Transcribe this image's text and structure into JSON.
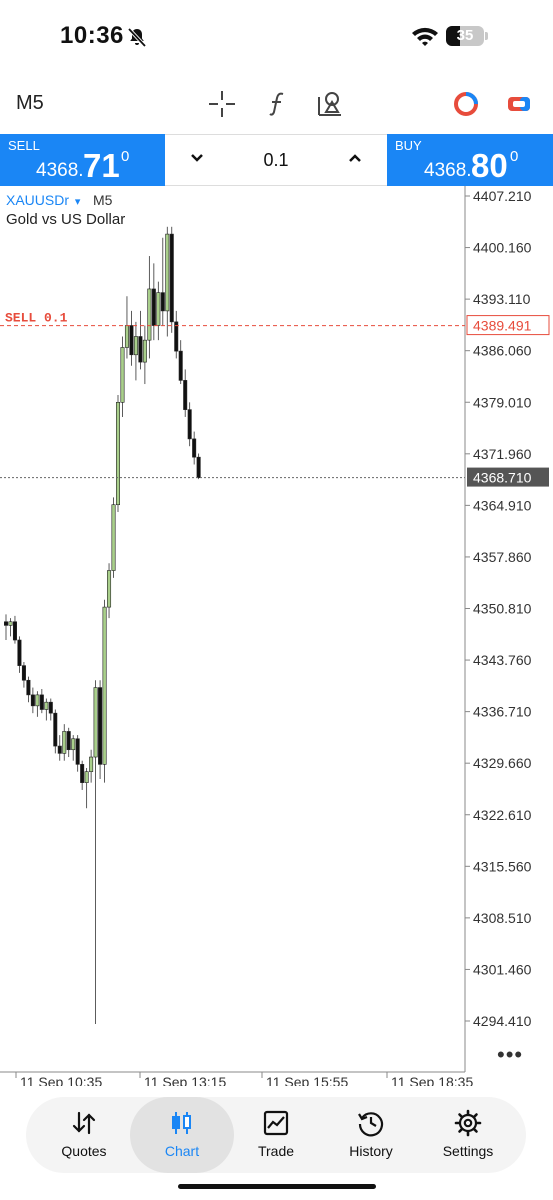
{
  "status_bar": {
    "time": "10:36",
    "battery": "35"
  },
  "toolbar": {
    "timeframe": "M5",
    "tool_icons": [
      "crosshair-icon",
      "function-icon",
      "objects-icon",
      "indicator-ring-icon",
      "trade-toggle-icon"
    ]
  },
  "trade_panel": {
    "sell": {
      "label": "SELL",
      "price_prefix": "4368.",
      "price_big": "71",
      "price_sup": "0"
    },
    "buy": {
      "label": "BUY",
      "price_prefix": "4368.",
      "price_big": "80",
      "price_sup": "0"
    },
    "volume": "0.1"
  },
  "chart": {
    "symbol": "XAUUSDr",
    "symbol_arrow": "▾",
    "timeframe": "M5",
    "description": "Gold vs US Dollar",
    "order_line_label": "SELL 0.1",
    "order_price": "4389.491",
    "current_price": "4368.710",
    "price_axis": [
      "4407.210",
      "4400.160",
      "4393.110",
      "4386.060",
      "4379.010",
      "4371.960",
      "4364.910",
      "4357.860",
      "4350.810",
      "4343.760",
      "4336.710",
      "4329.660",
      "4322.610",
      "4315.560",
      "4308.510",
      "4301.460",
      "4294.410"
    ],
    "time_axis": [
      "11 Sep 10:35",
      "11 Sep 13:15",
      "11 Sep 15:55",
      "11 Sep 18:35"
    ],
    "more": "•••",
    "colors": {
      "up": "#a9cf8b",
      "down": "#111111",
      "sell_line": "#e74c3c",
      "accent": "#1a86f5"
    }
  },
  "chart_data": {
    "type": "candlestick",
    "symbol": "XAUUSDr",
    "ylim": [
      4290.0,
      4409.0
    ],
    "candles": [
      {
        "o": 4349.0,
        "h": 4350.0,
        "l": 4346.5,
        "c": 4348.5
      },
      {
        "o": 4348.5,
        "h": 4349.5,
        "l": 4347.0,
        "c": 4349.0
      },
      {
        "o": 4349.0,
        "h": 4349.8,
        "l": 4346.0,
        "c": 4346.5
      },
      {
        "o": 4346.5,
        "h": 4347.0,
        "l": 4342.0,
        "c": 4343.0
      },
      {
        "o": 4343.0,
        "h": 4343.5,
        "l": 4340.0,
        "c": 4341.0
      },
      {
        "o": 4341.0,
        "h": 4341.5,
        "l": 4338.0,
        "c": 4339.0
      },
      {
        "o": 4339.0,
        "h": 4340.0,
        "l": 4336.5,
        "c": 4337.5
      },
      {
        "o": 4337.5,
        "h": 4339.5,
        "l": 4336.0,
        "c": 4339.0
      },
      {
        "o": 4339.0,
        "h": 4339.8,
        "l": 4336.5,
        "c": 4337.0
      },
      {
        "o": 4337.0,
        "h": 4338.5,
        "l": 4335.5,
        "c": 4338.0
      },
      {
        "o": 4338.0,
        "h": 4338.5,
        "l": 4335.5,
        "c": 4336.5
      },
      {
        "o": 4336.5,
        "h": 4337.0,
        "l": 4331.0,
        "c": 4332.0
      },
      {
        "o": 4332.0,
        "h": 4333.5,
        "l": 4330.0,
        "c": 4331.0
      },
      {
        "o": 4331.0,
        "h": 4335.0,
        "l": 4330.0,
        "c": 4334.0
      },
      {
        "o": 4334.0,
        "h": 4334.5,
        "l": 4330.5,
        "c": 4331.5
      },
      {
        "o": 4331.5,
        "h": 4333.5,
        "l": 4330.0,
        "c": 4333.0
      },
      {
        "o": 4333.0,
        "h": 4333.5,
        "l": 4328.5,
        "c": 4329.5
      },
      {
        "o": 4329.5,
        "h": 4330.0,
        "l": 4326.0,
        "c": 4327.0
      },
      {
        "o": 4327.0,
        "h": 4329.0,
        "l": 4323.5,
        "c": 4328.5
      },
      {
        "o": 4328.5,
        "h": 4331.5,
        "l": 4327.0,
        "c": 4330.5
      },
      {
        "o": 4330.5,
        "h": 4341.0,
        "l": 4294.0,
        "c": 4340.0
      },
      {
        "o": 4340.0,
        "h": 4341.0,
        "l": 4327.5,
        "c": 4329.5
      },
      {
        "o": 4329.5,
        "h": 4352.0,
        "l": 4327.0,
        "c": 4351.0
      },
      {
        "o": 4351.0,
        "h": 4357.0,
        "l": 4349.5,
        "c": 4356.0
      },
      {
        "o": 4356.0,
        "h": 4366.0,
        "l": 4355.0,
        "c": 4365.0
      },
      {
        "o": 4365.0,
        "h": 4380.0,
        "l": 4364.0,
        "c": 4379.0
      },
      {
        "o": 4379.0,
        "h": 4388.0,
        "l": 4377.0,
        "c": 4386.5
      },
      {
        "o": 4386.5,
        "h": 4393.5,
        "l": 4385.0,
        "c": 4389.5
      },
      {
        "o": 4389.5,
        "h": 4391.5,
        "l": 4384.0,
        "c": 4385.5
      },
      {
        "o": 4385.5,
        "h": 4390.0,
        "l": 4382.0,
        "c": 4388.0
      },
      {
        "o": 4388.0,
        "h": 4391.5,
        "l": 4383.5,
        "c": 4384.5
      },
      {
        "o": 4384.5,
        "h": 4389.5,
        "l": 4381.5,
        "c": 4387.5
      },
      {
        "o": 4387.5,
        "h": 4399.0,
        "l": 4385.0,
        "c": 4394.5
      },
      {
        "o": 4394.5,
        "h": 4398.0,
        "l": 4387.5,
        "c": 4389.5
      },
      {
        "o": 4389.5,
        "h": 4395.5,
        "l": 4387.5,
        "c": 4394.0
      },
      {
        "o": 4394.0,
        "h": 4401.5,
        "l": 4389.5,
        "c": 4391.5
      },
      {
        "o": 4391.5,
        "h": 4403.0,
        "l": 4388.0,
        "c": 4402.0
      },
      {
        "o": 4402.0,
        "h": 4403.0,
        "l": 4388.5,
        "c": 4390.0
      },
      {
        "o": 4390.0,
        "h": 4391.5,
        "l": 4385.0,
        "c": 4386.0
      },
      {
        "o": 4386.0,
        "h": 4387.5,
        "l": 4381.5,
        "c": 4382.0
      },
      {
        "o": 4382.0,
        "h": 4383.5,
        "l": 4377.0,
        "c": 4378.0
      },
      {
        "o": 4378.0,
        "h": 4379.0,
        "l": 4373.0,
        "c": 4374.0
      },
      {
        "o": 4374.0,
        "h": 4375.0,
        "l": 4370.5,
        "c": 4371.5
      },
      {
        "o": 4371.5,
        "h": 4372.0,
        "l": 4368.5,
        "c": 4368.7
      }
    ]
  },
  "bottom_nav": [
    {
      "label": "Quotes",
      "icon": "quotes-arrows-icon",
      "active": false
    },
    {
      "label": "Chart",
      "icon": "candlestick-chart-icon",
      "active": true
    },
    {
      "label": "Trade",
      "icon": "trade-chart-icon",
      "active": false
    },
    {
      "label": "History",
      "icon": "history-clock-icon",
      "active": false
    },
    {
      "label": "Settings",
      "icon": "settings-gear-icon",
      "active": false
    }
  ]
}
